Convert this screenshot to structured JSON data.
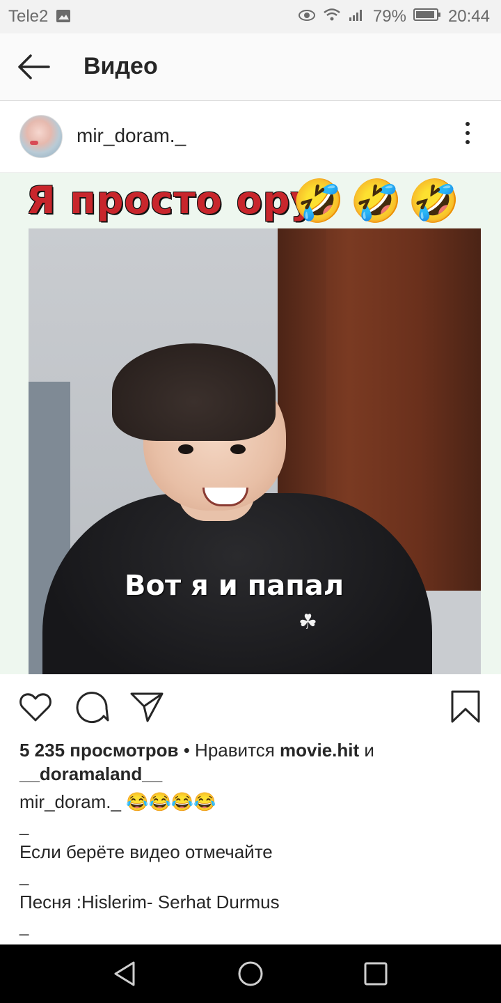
{
  "status_bar": {
    "carrier": "Tele2",
    "battery": "79%",
    "time": "20:44"
  },
  "app_bar": {
    "title": "Видео"
  },
  "post": {
    "username": "mir_doram._",
    "media": {
      "caption_overlay": "Я просто ору",
      "emoji": [
        "🤣",
        "🤣",
        "🤣"
      ],
      "subtitle": "Вот я и папал"
    },
    "views": "5 235 просмотров",
    "likes_prefix": "• Нравится",
    "liked_by_1": "movie.hit",
    "likes_connector": "и",
    "liked_by_2": "__doramaland__",
    "caption_author": "mir_doram._",
    "caption_emoji": "😂😂😂😂",
    "caption_lines": [
      "_",
      "Если берёте видео отмечайте",
      "_",
      "Песня :Hislerim- Serhat Durmus",
      "_"
    ]
  },
  "icons": {
    "back": "arrow-left-icon",
    "more": "more-vertical-icon",
    "like": "heart-icon",
    "comment": "comment-icon",
    "share": "paper-plane-icon",
    "save": "bookmark-icon"
  }
}
